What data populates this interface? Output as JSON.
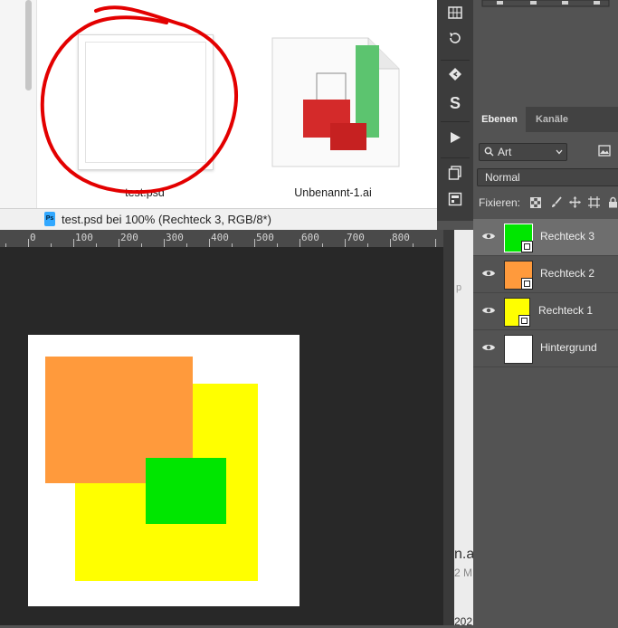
{
  "finder": {
    "files": [
      {
        "name": "test.psd"
      },
      {
        "name": "Unbenannt-1.ai"
      }
    ]
  },
  "document": {
    "tab_title": "test.psd bei 100% (Rechteck 3, RGB/8*)",
    "ps_icon_text": "Ps"
  },
  "ruler": {
    "labels": [
      "0",
      "100",
      "200",
      "300",
      "400",
      "500",
      "600",
      "700",
      "800"
    ]
  },
  "peek": {
    "text_a": "p",
    "text_b": "n.a",
    "text_c": "2 M",
    "text_d": "202"
  },
  "layers_panel": {
    "tabs": {
      "layers": "Ebenen",
      "channels": "Kanäle"
    },
    "filter": "Art",
    "blend_mode": "Normal",
    "lock_label": "Fixieren:",
    "layers": [
      {
        "name": "Rechteck 3",
        "color": "#00e600",
        "selected": true
      },
      {
        "name": "Rechteck 2",
        "color": "#ff9a3c",
        "selected": false
      },
      {
        "name": "Rechteck 1",
        "color": "#ffff00",
        "selected": false
      },
      {
        "name": "Hintergrund",
        "color": "#ffffff",
        "selected": false
      }
    ]
  },
  "colors": {
    "orange": "#ff9a3c",
    "yellow": "#ffff00",
    "green": "#00e600",
    "annotation_red": "#e30000"
  }
}
